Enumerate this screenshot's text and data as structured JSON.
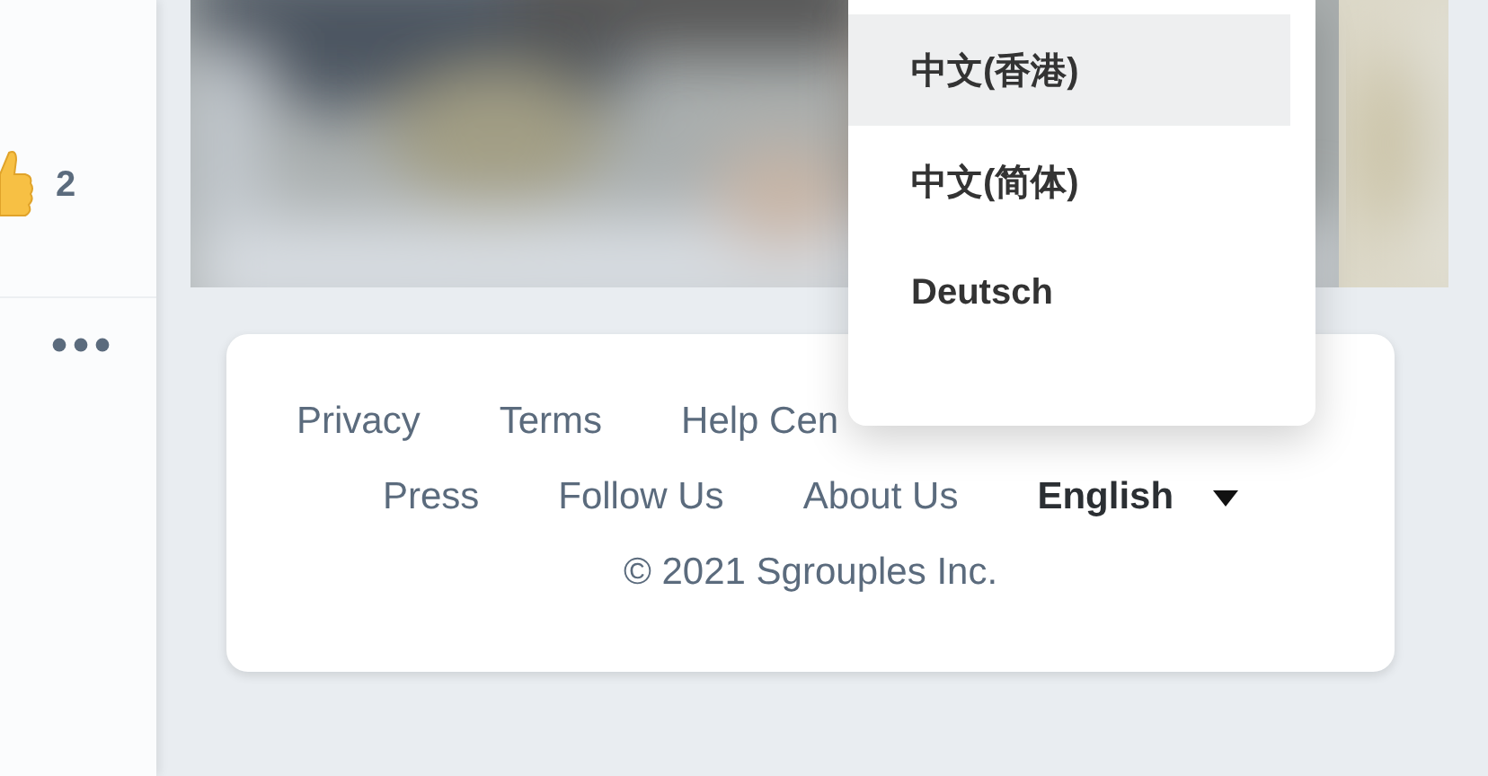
{
  "post_actions": {
    "like_count": "2"
  },
  "footer": {
    "rows": [
      [
        {
          "label": "Privacy"
        },
        {
          "label": "Terms"
        },
        {
          "label": "Help Cen"
        }
      ],
      [
        {
          "label": "Press"
        },
        {
          "label": "Follow Us"
        },
        {
          "label": "About Us"
        }
      ]
    ],
    "language": "English",
    "copyright": "© 2021 Sgrouples Inc."
  },
  "language_menu": {
    "items": [
      {
        "label": "中文(香港)",
        "selected": true
      },
      {
        "label": "中文(简体)",
        "selected": false
      },
      {
        "label": "Deutsch",
        "selected": false
      }
    ]
  }
}
